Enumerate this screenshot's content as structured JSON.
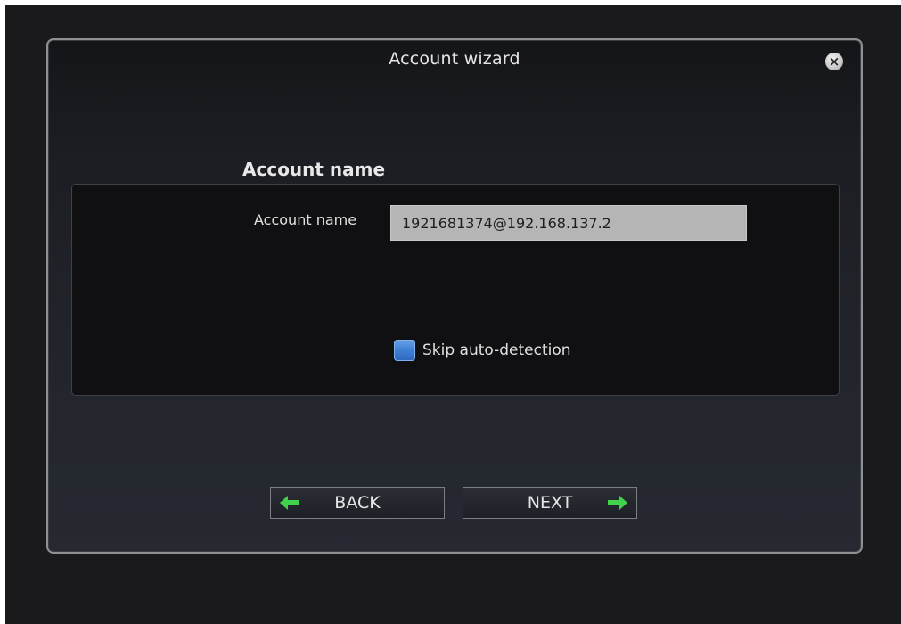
{
  "dialog": {
    "title": "Account wizard",
    "close_icon": "close-circle-icon"
  },
  "section": {
    "heading": "Account name"
  },
  "form": {
    "account_name_label": "Account name",
    "account_name_value": "1921681374@192.168.137.2",
    "skip_label": "Skip auto-detection"
  },
  "buttons": {
    "back_label": "BACK",
    "back_icon": "left-arrow-icon",
    "next_label": "NEXT",
    "next_icon": "right-arrow-icon"
  },
  "colors": {
    "arrow_green": "#3fd24a",
    "checkbox_blue": "#3f7fd6"
  }
}
